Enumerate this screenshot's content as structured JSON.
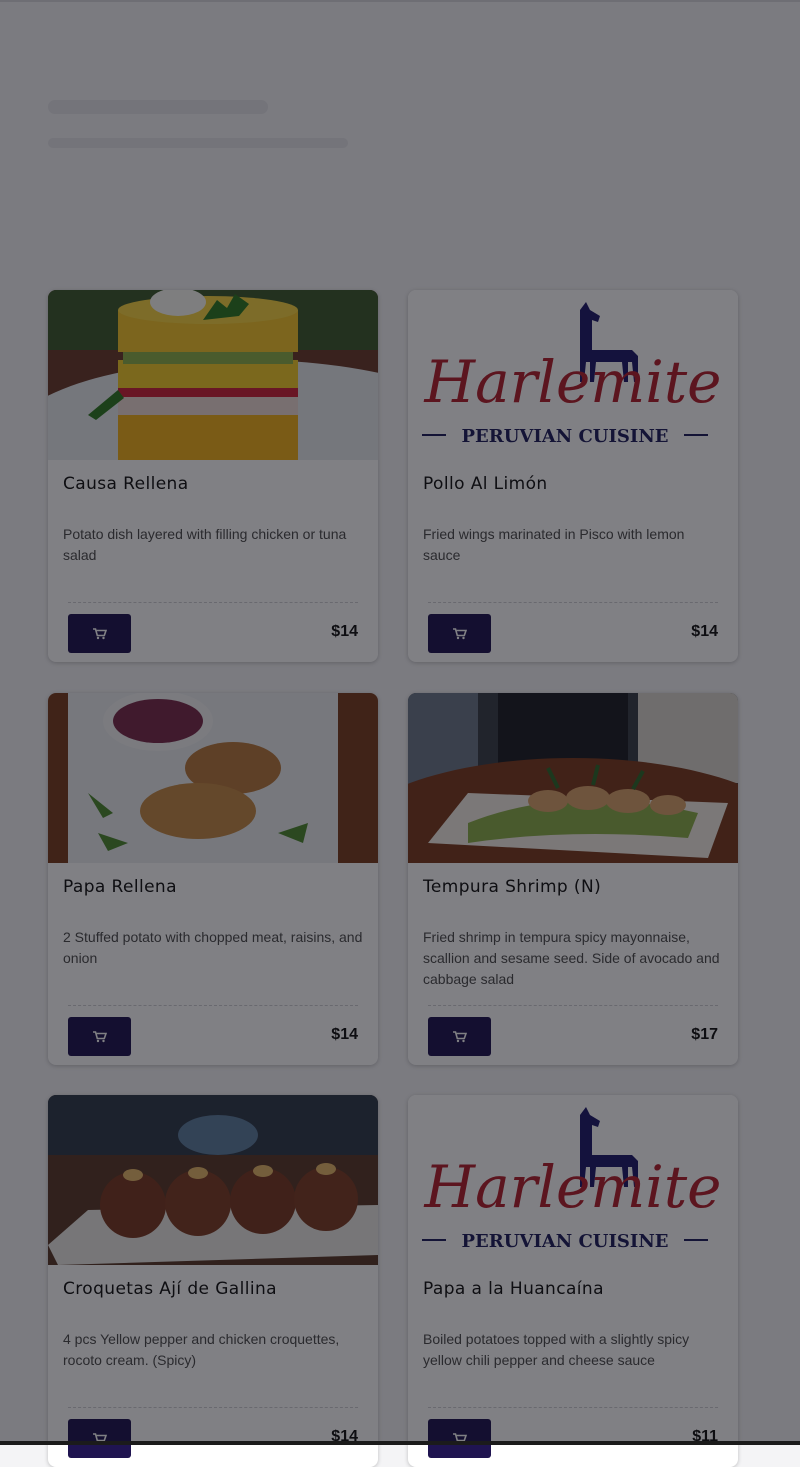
{
  "theme": {
    "accent": "#1f1450",
    "price_color": "#111111"
  },
  "menu": {
    "items": [
      {
        "title": "Causa Rellena",
        "description": "Potato dish layered with filling chicken or tuna salad",
        "price": "$14",
        "image": "causa-photo",
        "cart_icon": "cart-icon"
      },
      {
        "title": "Pollo Al Limón",
        "description": "Fried wings marinated in Pisco with lemon sauce",
        "price": "$14",
        "image": "logo",
        "cart_icon": "cart-icon"
      },
      {
        "title": "Papa Rellena",
        "description": "2 Stuffed potato with chopped meat, raisins, and onion",
        "price": "$14",
        "image": "papa-photo",
        "cart_icon": "cart-icon"
      },
      {
        "title": "Tempura Shrimp (N)",
        "description": "Fried shrimp in tempura spicy mayonnaise, scallion and sesame seed. Side of avocado and cabbage salad",
        "price": "$17",
        "image": "shrimp-photo",
        "cart_icon": "cart-icon"
      },
      {
        "title": "Croquetas Ají de Gallina",
        "description": "4 pcs Yellow pepper and chicken croquettes, rocoto cream. (Spicy)",
        "price": "$14",
        "image": "croquetas-photo",
        "cart_icon": "cart-icon"
      },
      {
        "title": "Papa a la Huancaína",
        "description": "Boiled potatoes topped with a slightly spicy yellow chili pepper and cheese sauce",
        "price": "$11",
        "image": "logo",
        "cart_icon": "cart-icon"
      }
    ]
  },
  "logo": {
    "wordmark": "Harlemite",
    "tagline": "PERUVIAN CUISINE",
    "wordmark_color": "#b3202c",
    "tagline_color": "#1f1f5c"
  }
}
